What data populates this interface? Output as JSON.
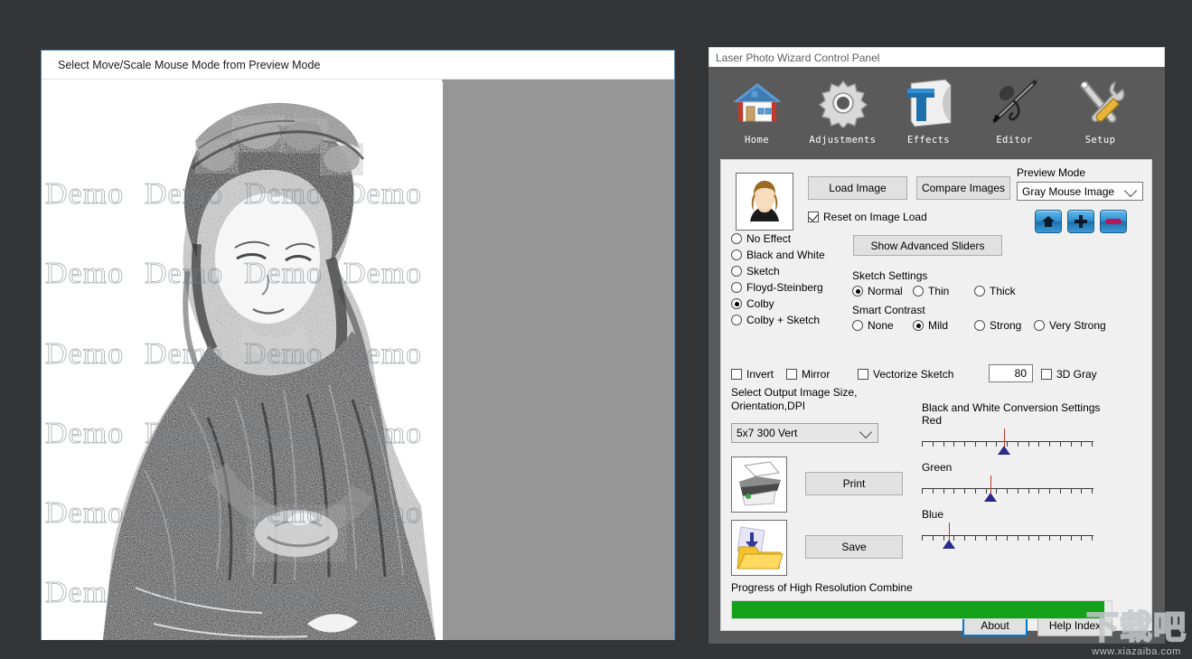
{
  "preview_window": {
    "title": "Select Move/Scale Mouse Mode from Preview Mode",
    "watermark_text": "Demo"
  },
  "control_panel": {
    "title": "Laser Photo Wizard Control Panel",
    "toolbar": [
      {
        "label": "Home",
        "icon": "home-icon"
      },
      {
        "label": "Adjustments",
        "icon": "gear-icon"
      },
      {
        "label": "Effects",
        "icon": "text-effects-icon"
      },
      {
        "label": "Editor",
        "icon": "airbrush-pen-icon"
      },
      {
        "label": "Setup",
        "icon": "tools-wrench-screwdriver-icon"
      }
    ],
    "load_image_label": "Load Image",
    "compare_images_label": "Compare Images",
    "reset_on_image_load_label": "Reset on Image Load",
    "reset_on_image_load_checked": true,
    "show_advanced_sliders_label": "Show Advanced Sliders",
    "preview_mode_label": "Preview Mode",
    "preview_mode_value": "Gray Mouse Image",
    "nav_buttons": [
      {
        "name": "home-button",
        "icon": "home-icon"
      },
      {
        "name": "zoom-in-button",
        "icon": "plus-icon"
      },
      {
        "name": "zoom-out-button",
        "icon": "minus-icon"
      }
    ],
    "effects": {
      "selected": "Colby",
      "options": [
        "No Effect",
        "Black and White",
        "Sketch",
        "Floyd-Steinberg",
        "Colby",
        "Colby + Sketch"
      ]
    },
    "sketch_settings": {
      "label": "Sketch Settings",
      "selected": "Normal",
      "options": [
        "Normal",
        "Thin",
        "Thick"
      ]
    },
    "smart_contrast": {
      "label": "Smart Contrast",
      "selected": "Mild",
      "options": [
        "None",
        "Mild",
        "Strong",
        "Very Strong"
      ]
    },
    "checkboxes": {
      "invert": {
        "label": "Invert",
        "checked": false
      },
      "mirror": {
        "label": "Mirror",
        "checked": false
      },
      "vectorize_sketch": {
        "label": "Vectorize Sketch",
        "checked": false
      },
      "three_d_gray": {
        "label": "3D Gray",
        "checked": false
      }
    },
    "threshold_value": "80",
    "output_size_label_line1": "Select Output Image Size,",
    "output_size_label_line2": "Orientation,DPI",
    "output_size_value": "5x7 300 Vert",
    "print_label": "Print",
    "save_label": "Save",
    "progress_label": "Progress of High Resolution Combine",
    "progress_percent": 98,
    "about_label": "About",
    "help_index_label": "Help Index",
    "bw_conversion": {
      "title": "Black and White Conversion Settings",
      "sliders": [
        {
          "label": "Red",
          "value_percent": 48
        },
        {
          "label": "Green",
          "value_percent": 40
        },
        {
          "label": "Blue",
          "value_percent": 16
        }
      ],
      "tick_count": 16
    }
  },
  "site_watermark": {
    "cn_text": "下载吧",
    "url_text": "www.xiazaiba.com"
  },
  "colors": {
    "desktop": "#333436",
    "panel_frame": "#5a5a5a",
    "panel_body": "#f0f0f0",
    "progress_green": "#12a118",
    "focus_blue": "#0078d7",
    "gray_pad": "#969696"
  }
}
